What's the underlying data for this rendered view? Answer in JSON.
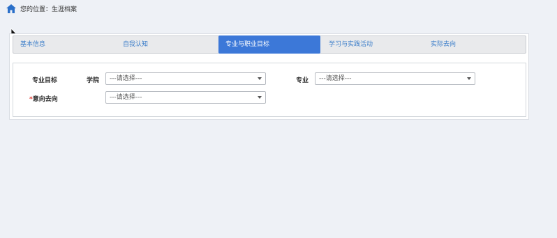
{
  "breadcrumb": {
    "text": "您的位置：生涯档案",
    "icon": "home-icon",
    "icon_color": "#2a6fc9"
  },
  "tabs": [
    {
      "label": "基本信息",
      "active": false
    },
    {
      "label": "自我认知",
      "active": false
    },
    {
      "label": "专业与职业目标",
      "active": true
    },
    {
      "label": "学习与实践活动",
      "active": false
    },
    {
      "label": "实际去向",
      "active": false
    }
  ],
  "form": {
    "section_label": "专业目标",
    "college_label": "学院",
    "college_value": "---请选择---",
    "major_label": "专业",
    "major_value": "---请选择---",
    "intention_required_mark": "*",
    "intention_label": "意向去向",
    "intention_value": "---请选择---"
  },
  "colors": {
    "accent": "#3c78d8",
    "background": "#eef1f6",
    "required": "#e0372e"
  }
}
